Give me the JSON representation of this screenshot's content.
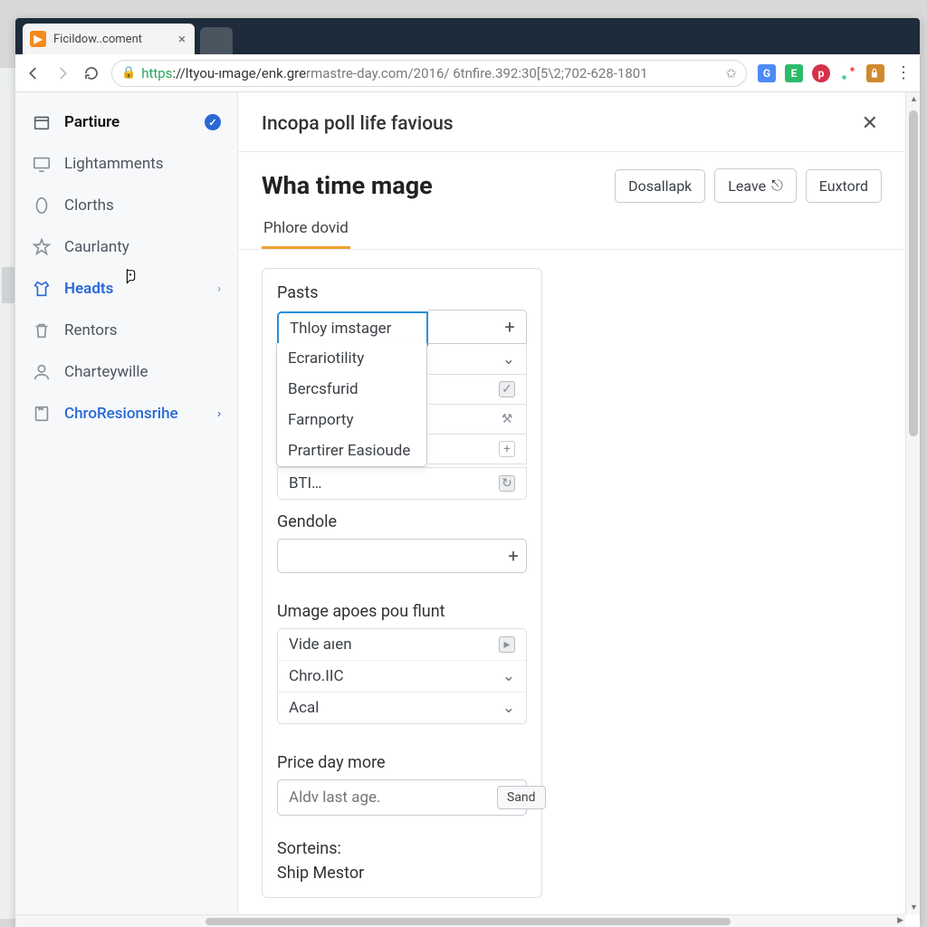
{
  "tab": {
    "title": "Ficildow..coment"
  },
  "url": {
    "scheme": "https",
    "host": "://ltyou-ımage/enk.gre",
    "path": "rmastre-day.com/2016/ 6tnfire.392:30[5\\2;702-628-1801"
  },
  "sidebar": {
    "items": [
      {
        "label": "Partiure",
        "icon": "box",
        "active": true,
        "badge": "✓"
      },
      {
        "label": "Lightamments",
        "icon": "monitor"
      },
      {
        "label": "Clorths",
        "icon": "oval"
      },
      {
        "label": "Caurlanty",
        "icon": "star"
      },
      {
        "label": "Headts",
        "icon": "shirt",
        "selected": true,
        "chevron": true
      },
      {
        "label": "Rentors",
        "icon": "trash"
      },
      {
        "label": "Charteywille",
        "icon": "person"
      },
      {
        "label": "ChroResionsrihe",
        "icon": "note",
        "link": true,
        "chevron": true
      }
    ]
  },
  "page": {
    "breadcrumb": "Incopa poll life favious",
    "title": "Wha time mage",
    "buttons": {
      "b1": "Dosallapk",
      "b2": "Leave",
      "b3": "Euxtord"
    },
    "tab": "Phlore dovid"
  },
  "form": {
    "pasts": {
      "label": "Pasts",
      "input": "Thloy imstager",
      "options": [
        "Ecrariotility",
        "Bercsfurid",
        "Farnporty",
        "Prartirer Easioude"
      ],
      "bti": "BTI…"
    },
    "gendole": {
      "label": "Gendole"
    },
    "umage": {
      "label": "Umage apoes pou flunt",
      "rows": [
        "Vide aıen",
        "Chro.IIC",
        "Acal"
      ]
    },
    "price": {
      "label": "Price day more",
      "placeholder": "Aldv last age.",
      "send": "Sand"
    },
    "sorteins": {
      "label": "Sorteins:",
      "value": "Ship Mestor"
    }
  }
}
